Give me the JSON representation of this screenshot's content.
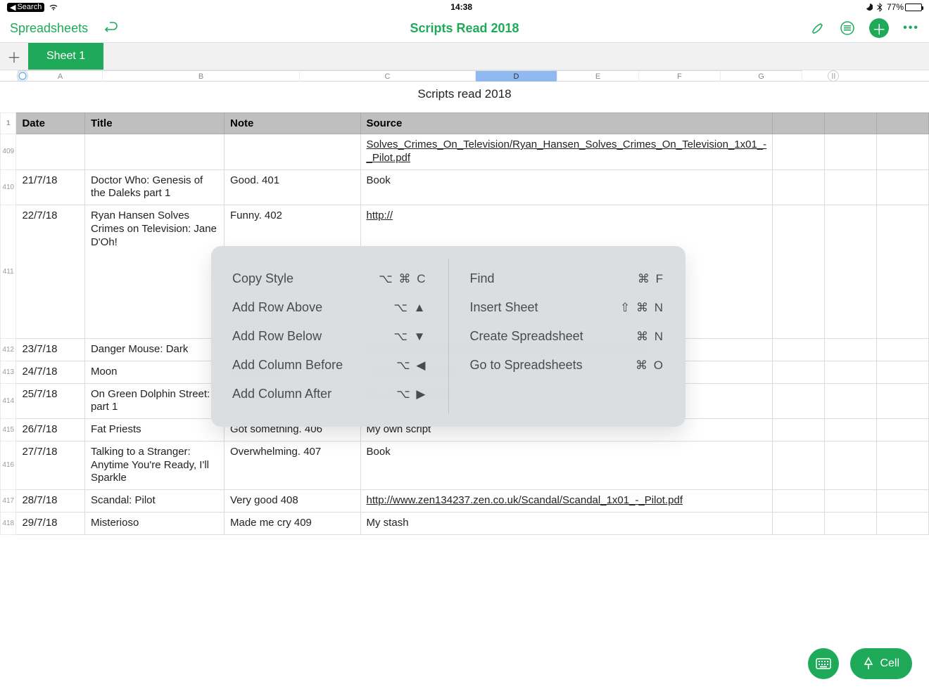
{
  "statusbar": {
    "back_app": "Search",
    "time": "14:38",
    "battery_pct": "77%",
    "battery_fill_pct": 77
  },
  "toolbar": {
    "back": "Spreadsheets",
    "title": "Scripts Read 2018"
  },
  "tabs": {
    "active": "Sheet 1"
  },
  "columns": [
    "A",
    "B",
    "C",
    "D",
    "E",
    "F",
    "G"
  ],
  "selected_column_index": 3,
  "sheet_title": "Scripts read 2018",
  "headers": {
    "rownum": "1",
    "cols": [
      "Date",
      "Title",
      "Note",
      "Source",
      "",
      "",
      ""
    ]
  },
  "rows": [
    {
      "num": "409",
      "date": "",
      "title": "",
      "note": "",
      "source": "Solves_Crimes_On_Television/Ryan_Hansen_Solves_Crimes_On_Television_1x01_-_Pilot.pdf",
      "source_link": true
    },
    {
      "num": "410",
      "date": "21/7/18",
      "title": "Doctor Who: Genesis of the Daleks part 1",
      "note": "Good. 401",
      "source": "Book"
    },
    {
      "num": "411",
      "date": "22/7/18",
      "title": "Ryan Hansen Solves Crimes on Television: Jane D'Oh!",
      "note": "Funny. 402",
      "source": "http://",
      "source_link": true,
      "tall": true
    },
    {
      "num": "412",
      "date": "23/7/18",
      "title": "Danger Mouse: Dark",
      "note": "",
      "source": "Mouse-S2-Ep56-Mark-Huckerby-Nick-Ostler-Dark-Dawn.pdf",
      "source_link": true
    },
    {
      "num": "413",
      "date": "24/7/18",
      "title": "Moon",
      "note": "Superb 404",
      "source": "Via Weekend Read"
    },
    {
      "num": "414",
      "date": "25/7/18",
      "title": "On Green Dolphin Street: part 1",
      "note": "Sad and sweet. 405",
      "source": "My research stash"
    },
    {
      "num": "415",
      "date": "26/7/18",
      "title": "Fat Priests",
      "note": "Got something. 406",
      "source": "My own script"
    },
    {
      "num": "416",
      "date": "27/7/18",
      "title": "Talking to a Stranger: Anytime You're Ready, I'll Sparkle",
      "note": "Overwhelming. 407",
      "source": "Book"
    },
    {
      "num": "417",
      "date": "28/7/18",
      "title": "Scandal: Pilot",
      "note": "Very good 408",
      "source": "http://www.zen134237.zen.co.uk/Scandal/Scandal_1x01_-_Pilot.pdf",
      "source_link": true
    },
    {
      "num": "418",
      "date": "29/7/18",
      "title": "Misterioso",
      "note": "Made me cry 409",
      "source": "My stash"
    }
  ],
  "popover": {
    "left": [
      {
        "label": "Copy Style",
        "shortcut": "⌥ ⌘ C"
      },
      {
        "label": "Add Row Above",
        "shortcut": "⌥ ▲"
      },
      {
        "label": "Add Row Below",
        "shortcut": "⌥ ▼"
      },
      {
        "label": "Add Column Before",
        "shortcut": "⌥ ◀"
      },
      {
        "label": "Add Column After",
        "shortcut": "⌥ ▶"
      }
    ],
    "right": [
      {
        "label": "Find",
        "shortcut": "⌘ F"
      },
      {
        "label": "Insert Sheet",
        "shortcut": "⇧ ⌘ N"
      },
      {
        "label": "Create Spreadsheet",
        "shortcut": "⌘ N"
      },
      {
        "label": "Go to Spreadsheets",
        "shortcut": "⌘ O"
      }
    ]
  },
  "fab_cell": "Cell"
}
